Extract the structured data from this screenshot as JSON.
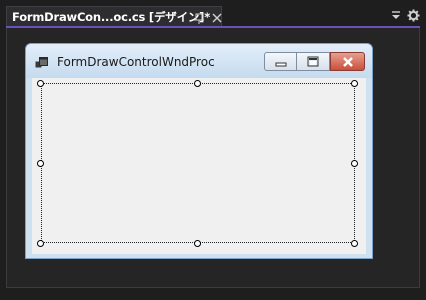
{
  "tab": {
    "title": "FormDrawCon...oc.cs [デザイン]*",
    "pin_icon": "pin-icon",
    "close_icon": "close-icon"
  },
  "strip": {
    "menu_icon": "dropdown-menu-icon",
    "settings_icon": "gear-icon"
  },
  "form": {
    "title": "FormDrawControlWndProc",
    "icon": "form-app-icon",
    "buttons": [
      "minimize",
      "maximize",
      "close"
    ]
  },
  "colors": {
    "accent": "#6b4fbb",
    "background": "#1e1e1e",
    "client": "#f0f0f0",
    "close_button": "#c9503c"
  }
}
